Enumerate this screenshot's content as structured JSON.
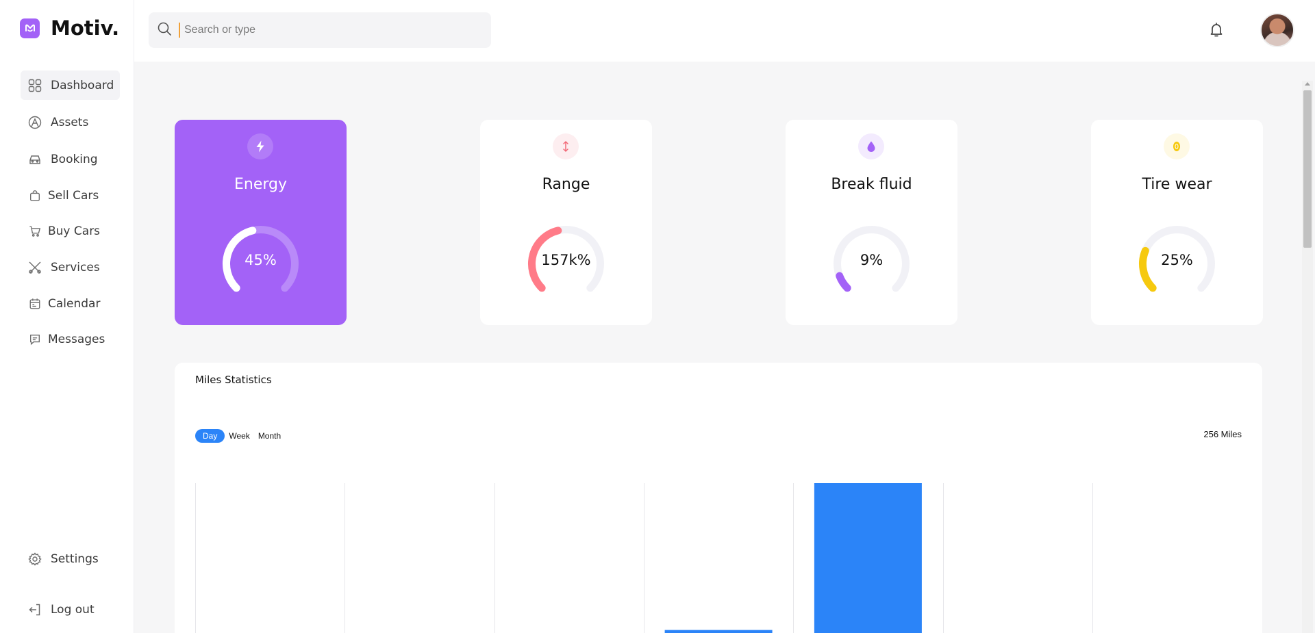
{
  "app": {
    "name": "Motiv."
  },
  "sidebar": {
    "items": [
      {
        "label": "Dashboard",
        "icon": "grid-icon",
        "active": true
      },
      {
        "label": "Assets",
        "icon": "assets-icon"
      },
      {
        "label": "Booking",
        "icon": "car-icon"
      },
      {
        "label": "Sell Cars",
        "icon": "shopping-bag-icon"
      },
      {
        "label": "Buy Cars",
        "icon": "cart-icon"
      },
      {
        "label": "Services",
        "icon": "tools-icon"
      },
      {
        "label": "Calendar",
        "icon": "calendar-icon"
      },
      {
        "label": "Messages",
        "icon": "message-icon"
      }
    ],
    "bottom": [
      {
        "label": "Settings",
        "icon": "gear-icon"
      },
      {
        "label": "Log out",
        "icon": "logout-icon"
      }
    ]
  },
  "header": {
    "search_placeholder": "Search or type",
    "search_value": ""
  },
  "cards": [
    {
      "title": "Energy",
      "value": "45%",
      "level": 0.45,
      "icon": "lightning-icon",
      "color": "#ffffff",
      "track": "#b98af9"
    },
    {
      "title": "Range",
      "value": "157k%",
      "level": 0.45,
      "icon": "vertical-arrows-icon",
      "color": "#ff7b88",
      "track": "#f1f1f6"
    },
    {
      "title": "Break fluid",
      "value": "9%",
      "level": 0.09,
      "icon": "droplet-icon",
      "color": "#a362f7",
      "track": "#f1f1f6"
    },
    {
      "title": "Tire wear",
      "value": "25%",
      "level": 0.25,
      "icon": "tire-icon",
      "color": "#f6c90e",
      "track": "#f1f1f6"
    }
  ],
  "stats": {
    "title": "Miles Statistics",
    "tabs": [
      "Day",
      "Week",
      "Month"
    ],
    "active_tab": "Day",
    "total": "256 Miles"
  },
  "chart_data": {
    "type": "bar",
    "categories": [
      "",
      "",
      "",
      "",
      "",
      "",
      ""
    ],
    "values": [
      0,
      0,
      0,
      2,
      100,
      0,
      0
    ],
    "ylim": [
      0,
      100
    ],
    "grid": true,
    "bar_color": "#2b84f8"
  },
  "colors": {
    "accent": "#a362f7",
    "blue": "#2b84f8"
  }
}
